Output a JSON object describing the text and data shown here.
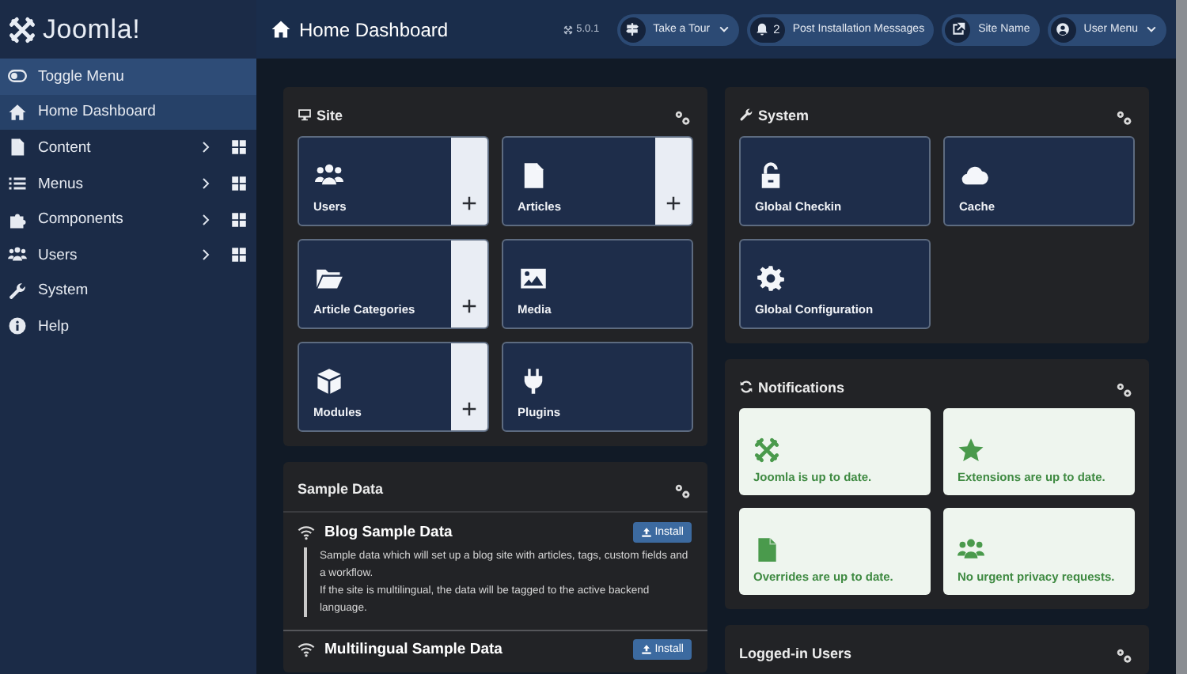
{
  "brand": {
    "name": "Joomla!"
  },
  "toggle_menu": {
    "label": "Toggle Menu"
  },
  "sidebar": {
    "items": [
      {
        "label": "Home Dashboard",
        "selected": true,
        "has_submenu": false
      },
      {
        "label": "Content",
        "selected": false,
        "has_submenu": true
      },
      {
        "label": "Menus",
        "selected": false,
        "has_submenu": true
      },
      {
        "label": "Components",
        "selected": false,
        "has_submenu": true
      },
      {
        "label": "Users",
        "selected": false,
        "has_submenu": true
      },
      {
        "label": "System",
        "selected": false,
        "has_submenu": false
      },
      {
        "label": "Help",
        "selected": false,
        "has_submenu": false
      }
    ]
  },
  "header": {
    "title": "Home Dashboard",
    "version": "5.0.1",
    "buttons": [
      {
        "label": "Take a Tour",
        "kind": "dropdown"
      },
      {
        "label": "Post Installation Messages",
        "kind": "badge",
        "badge": "2"
      },
      {
        "label": "Site Name",
        "kind": "link"
      },
      {
        "label": "User Menu",
        "kind": "dropdown"
      }
    ]
  },
  "columns": [
    [
      {
        "title": "Site",
        "kind": "tiles",
        "tiles": [
          {
            "label": "Users",
            "addable": true
          },
          {
            "label": "Articles",
            "addable": true
          },
          {
            "label": "Article Categories",
            "addable": true
          },
          {
            "label": "Media",
            "addable": false
          },
          {
            "label": "Modules",
            "addable": true
          },
          {
            "label": "Plugins",
            "addable": false
          }
        ]
      },
      {
        "title": "Sample Data",
        "kind": "sample",
        "items": [
          {
            "title": "Blog Sample Data",
            "button": "Install",
            "paragraphs": [
              "Sample data which will set up a blog site with articles, tags, custom fields and a workflow.",
              "If the site is multilingual, the data will be tagged to the active backend language."
            ]
          },
          {
            "title": "Multilingual Sample Data",
            "button": "Install"
          }
        ]
      }
    ],
    [
      {
        "title": "System",
        "kind": "tiles",
        "tiles": [
          {
            "label": "Global Checkin",
            "addable": false
          },
          {
            "label": "Cache",
            "addable": false
          },
          {
            "label": "Global Configuration",
            "addable": false
          }
        ]
      },
      {
        "title": "Notifications",
        "kind": "notices",
        "tiles": [
          {
            "label": "Joomla is up to date."
          },
          {
            "label": "Extensions are up to date."
          },
          {
            "label": "Overrides are up to date."
          },
          {
            "label": "No urgent privacy requests."
          }
        ]
      },
      {
        "title": "Logged-in Users",
        "kind": "empty"
      }
    ]
  ]
}
